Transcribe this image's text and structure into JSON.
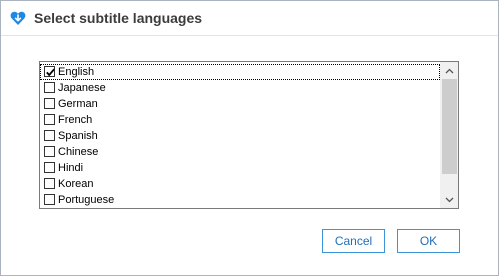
{
  "dialog": {
    "title": "Select subtitle languages",
    "accent_color": "#1e88e5"
  },
  "languages": [
    {
      "label": "English",
      "checked": true
    },
    {
      "label": "Japanese",
      "checked": false
    },
    {
      "label": "German",
      "checked": false
    },
    {
      "label": "French",
      "checked": false
    },
    {
      "label": "Spanish",
      "checked": false
    },
    {
      "label": "Chinese",
      "checked": false
    },
    {
      "label": "Hindi",
      "checked": false
    },
    {
      "label": "Korean",
      "checked": false
    },
    {
      "label": "Portuguese",
      "checked": false
    }
  ],
  "buttons": {
    "cancel_label": "Cancel",
    "ok_label": "OK"
  },
  "icons": {
    "app": "heart-download-icon",
    "scroll_up": "chevron-up-icon",
    "scroll_down": "chevron-down-icon",
    "checkbox_check": "checkmark-icon"
  }
}
